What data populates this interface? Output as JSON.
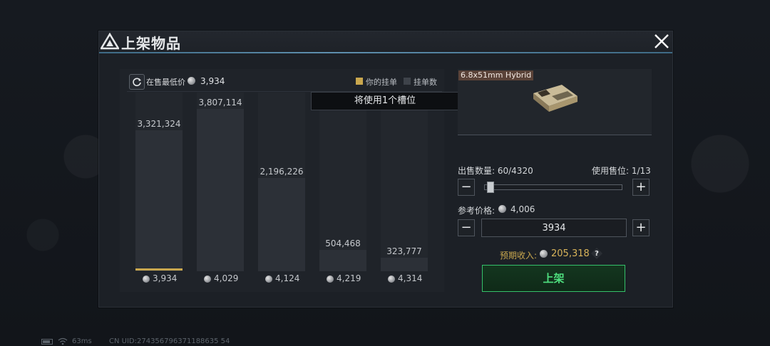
{
  "dialog": {
    "title": "上架物品"
  },
  "chart_header": {
    "lowest_label": "在售最低价",
    "lowest_value": "3,934",
    "legend_mine": "你的挂单",
    "legend_count": "挂单数"
  },
  "tooltip": "将使用1个槽位",
  "chart_data": {
    "type": "bar",
    "categories": [
      "3,934",
      "4,029",
      "4,124",
      "4,219",
      "4,314"
    ],
    "values": [
      3321324,
      3807114,
      2196226,
      504468,
      323777
    ],
    "value_labels": [
      "3,321,324",
      "3,807,114",
      "2,196,226",
      "504,468",
      "323,777"
    ],
    "ylim": [
      0,
      4200000
    ],
    "highlight_index": 0,
    "colors": {
      "bar": "#2c3037",
      "mine": "#c9a74e",
      "count": "#3e434a"
    }
  },
  "item": {
    "name": "6.8x51mm Hybrid"
  },
  "controls": {
    "qty_label": "出售数量: 60/4320",
    "slot_label": "使用售位: 1/13",
    "qty_fraction": 0.0139,
    "minus": "−",
    "plus": "+",
    "ref_label": "参考价格:",
    "ref_value": "4,006",
    "price_value": "3934",
    "income_label": "预期收入:",
    "income_value": "205,318",
    "help": "?",
    "list_button": "上架"
  },
  "status": {
    "ping": "63ms",
    "uid": "CN UID:274356796371188635 54"
  },
  "colors": {
    "accent_green": "#35c06a",
    "gold": "#c9a74e",
    "header_rule": "#5e8fae"
  }
}
